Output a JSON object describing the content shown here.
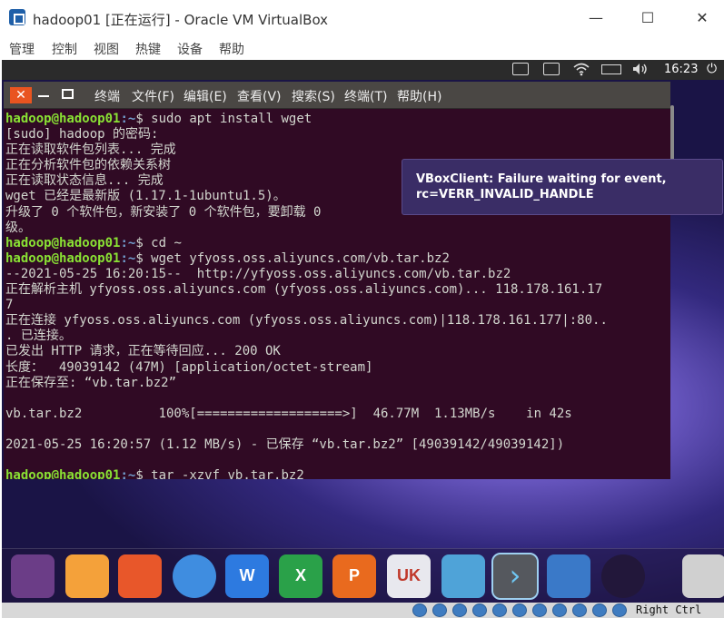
{
  "window": {
    "title": "hadoop01 [正在运行] - Oracle VM VirtualBox",
    "minimize_glyph": "—",
    "maximize_glyph": "☐",
    "close_glyph": "✕"
  },
  "host_menu": [
    "管理",
    "控制",
    "视图",
    "热键",
    "设备",
    "帮助"
  ],
  "guest_panel": {
    "clock": "16:23",
    "power_glyph": "⏻",
    "icons": [
      "keyboard-icon",
      "keyboard-icon",
      "wifi-icon",
      "battery-icon",
      "volume-icon",
      "power-icon"
    ]
  },
  "terminal": {
    "close_glyph": "✕",
    "menu": [
      "终端",
      "文件(F)",
      "编辑(E)",
      "查看(V)",
      "搜索(S)",
      "终端(T)",
      "帮助(H)"
    ],
    "prompt_user": "hadoop@hadoop01",
    "prompt_path": "~",
    "prompt_sym": "$ ",
    "lines": [
      {
        "prompt": true,
        "cmd": "sudo apt install wget"
      },
      {
        "text": "[sudo] hadoop 的密码:"
      },
      {
        "text": "正在读取软件包列表... 完成"
      },
      {
        "text": "正在分析软件包的依赖关系树"
      },
      {
        "text": "正在读取状态信息... 完成"
      },
      {
        "text": "wget 已经是最新版 (1.17.1-1ubuntu1.5)。"
      },
      {
        "text": "升级了 0 个软件包，新安装了 0 个软件包，要卸载 0"
      },
      {
        "text": "级。"
      },
      {
        "prompt": true,
        "cmd": "cd ~"
      },
      {
        "prompt": true,
        "cmd": "wget yfyoss.oss.aliyuncs.com/vb.tar.bz2"
      },
      {
        "text": "--2021-05-25 16:20:15--  http://yfyoss.oss.aliyuncs.com/vb.tar.bz2"
      },
      {
        "text": "正在解析主机 yfyoss.oss.aliyuncs.com (yfyoss.oss.aliyuncs.com)... 118.178.161.17"
      },
      {
        "text": "7"
      },
      {
        "text": "正在连接 yfyoss.oss.aliyuncs.com (yfyoss.oss.aliyuncs.com)|118.178.161.177|:80.."
      },
      {
        "text": ". 已连接。"
      },
      {
        "text": "已发出 HTTP 请求，正在等待回应... 200 OK"
      },
      {
        "text": "长度：  49039142 (47M) [application/octet-stream]"
      },
      {
        "text": "正在保存至: “vb.tar.bz2”"
      },
      {
        "text": ""
      },
      {
        "text": "vb.tar.bz2          100%[===================>]  46.77M  1.13MB/s    in 42s"
      },
      {
        "text": ""
      },
      {
        "text": "2021-05-25 16:20:57 (1.12 MB/s) - 已保存 “vb.tar.bz2” [49039142/49039142])"
      },
      {
        "text": ""
      },
      {
        "prompt": true,
        "cmd": "tar -xzvf vb.tar.bz2"
      }
    ]
  },
  "notification": {
    "line1": "VBoxClient: Failure waiting for event,",
    "line2": "rc=VERR_INVALID_HANDLE"
  },
  "dock": {
    "apps": [
      {
        "name": "ubuntu-launcher-icon",
        "color": "#6b3d87"
      },
      {
        "name": "files-icon",
        "color": "#f4a13a"
      },
      {
        "name": "firefox-icon",
        "color": "#e8572a"
      },
      {
        "name": "chromium-icon",
        "color": "#3f8de0"
      },
      {
        "name": "wps-writer-icon",
        "color": "#2d7ae0"
      },
      {
        "name": "wps-spreadsheet-icon",
        "color": "#2aa149"
      },
      {
        "name": "wps-presentation-icon",
        "color": "#e96a1e"
      },
      {
        "name": "ubuntu-kylin-icon",
        "color": "#e8e8ee"
      },
      {
        "name": "software-center-icon",
        "color": "#4fa3d8"
      },
      {
        "name": "terminal-icon",
        "color": "#55585e"
      },
      {
        "name": "system-settings-icon",
        "color": "#3a79c8"
      },
      {
        "name": "dvd-icon",
        "color": "#22173a"
      },
      {
        "name": "trash-icon",
        "color": "#d0d0d0"
      }
    ],
    "uk_label": "UK",
    "writer_label": "W",
    "sheet_label": "X",
    "ppt_label": "P"
  },
  "statusbar": {
    "host_key": "Right Ctrl"
  },
  "colors": {
    "terminal_bg": "#300a24",
    "prompt_user": "#8ae234",
    "prompt_path": "#729fcf",
    "ubuntu_orange": "#e95420"
  }
}
